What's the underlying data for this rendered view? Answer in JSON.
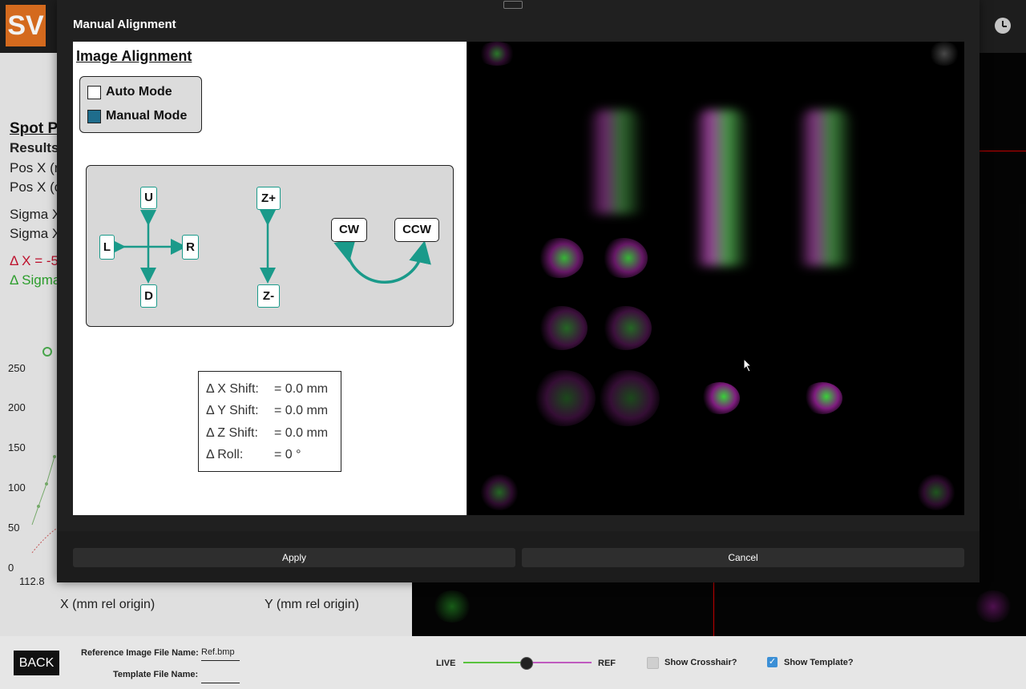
{
  "app": {
    "logo_text": "SV"
  },
  "background": {
    "heading": "Spot P",
    "results": "Results",
    "pos_x_1": "Pos X (r",
    "pos_x_2": "Pos X (c",
    "sigma_x_1": "Sigma X",
    "sigma_x_2": "Sigma X",
    "delta_x": "Δ X = -5",
    "delta_sigma": "Δ Sigma",
    "y_ticks": [
      "250",
      "200",
      "150",
      "100",
      "50",
      "0"
    ],
    "x_tick": "112.8",
    "x_axis_label": "X (mm rel origin)",
    "y_axis_label": "Y (mm rel origin)",
    "colors": {
      "red": "#c8102e",
      "green": "#2ea62e"
    }
  },
  "bottom_bar": {
    "back_label": "BACK",
    "ref_image_label": "Reference Image File Name:",
    "ref_image_value": "Ref.bmp",
    "template_label": "Template File Name:",
    "template_value": "",
    "live_label": "LIVE",
    "ref_label": "REF",
    "slider_value": 0.5,
    "show_crosshair_label": "Show Crosshair?",
    "show_crosshair_checked": false,
    "show_template_label": "Show Template?",
    "show_template_checked": true
  },
  "dialog": {
    "title": "Manual Alignment",
    "heading": "Image Alignment",
    "modes": [
      {
        "label": "Auto Mode",
        "selected": false
      },
      {
        "label": "Manual Mode",
        "selected": true
      }
    ],
    "buttons": {
      "up": "U",
      "down": "D",
      "left": "L",
      "right": "R",
      "z_plus": "Z+",
      "z_minus": "Z-",
      "cw": "CW",
      "ccw": "CCW"
    },
    "shifts": [
      {
        "label": "Δ X Shift:",
        "value": "= 0.0 mm"
      },
      {
        "label": "Δ Y Shift:",
        "value": "= 0.0 mm"
      },
      {
        "label": "Δ Z Shift:",
        "value": "= 0.0 mm"
      },
      {
        "label": "Δ Roll:",
        "value": "= 0 °"
      }
    ],
    "apply_label": "Apply",
    "cancel_label": "Cancel",
    "accent_color": "#1a9a8a",
    "selected_color": "#1f6d8c"
  }
}
